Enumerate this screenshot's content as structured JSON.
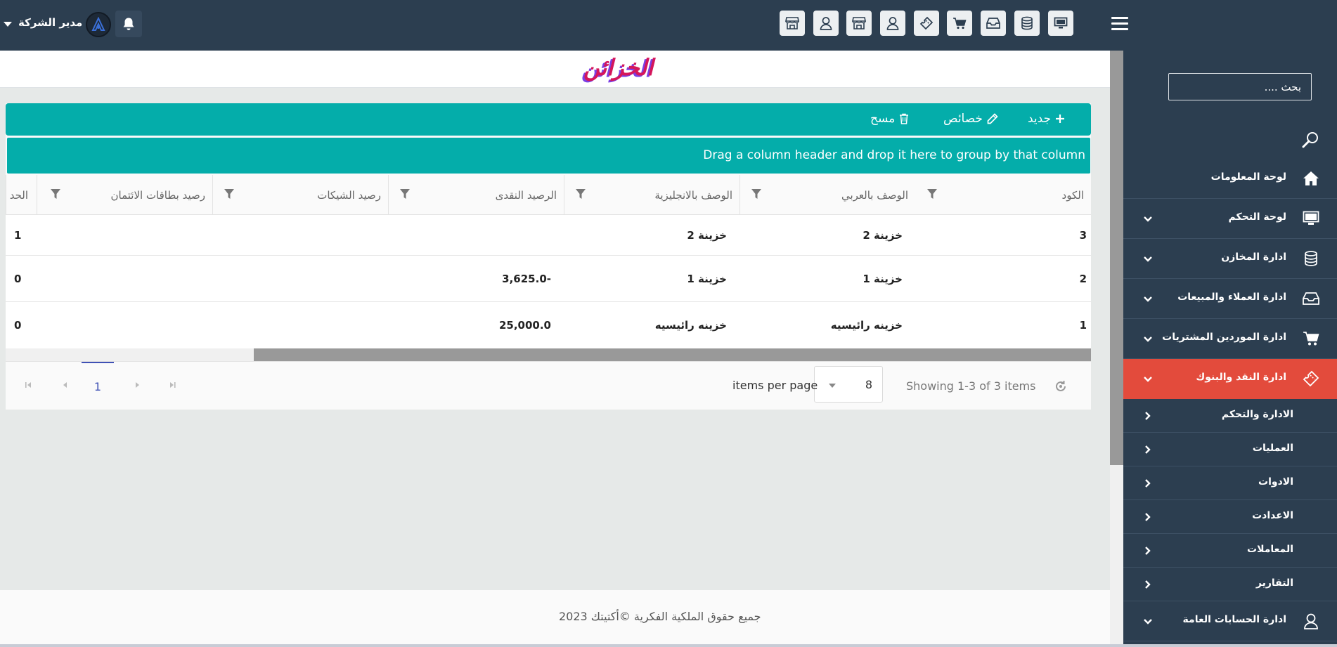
{
  "topbar": {
    "user_name": "مدير الشركة",
    "icons": [
      "monitor-icon",
      "database-icon",
      "inbox-icon",
      "cart-icon",
      "ticket-icon",
      "user-icon",
      "store-icon",
      "user-icon",
      "store-icon"
    ]
  },
  "sidebar": {
    "search_placeholder": "بحث ....",
    "items": [
      {
        "label": "لوحة المعلومات",
        "icon": "home-icon",
        "chevron": false
      },
      {
        "label": "لوحة التحكم",
        "icon": "monitor-icon",
        "chevron": true
      },
      {
        "label": "ادارة المخازن",
        "icon": "database-icon",
        "chevron": true
      },
      {
        "label": "ادارة العملاء والمبيعات",
        "icon": "inbox-icon",
        "chevron": true
      },
      {
        "label": "ادارة الموردين المشتريات",
        "icon": "cart-icon",
        "chevron": true
      },
      {
        "label": "ادارة النقد والبنوك",
        "icon": "ticket-icon",
        "chevron": true,
        "active": true
      }
    ],
    "sub_items": [
      "الادارة والتحكم",
      "العمليات",
      "الادوات",
      "الاعدادت",
      "المعاملات",
      "التقارير"
    ],
    "last_item": {
      "label": "ادارة الحسابات العامة",
      "icon": "user-icon"
    },
    "active_color": "#e34b3c"
  },
  "page": {
    "title": "الخزائن"
  },
  "toolbar": {
    "new_label": "جديد",
    "props_label": "خصائص",
    "delete_label": "مسح"
  },
  "grid": {
    "group_hint": "Drag a column header and drop it here to group by that column",
    "columns": [
      "الكود",
      "الوصف بالعربي",
      "الوصف بالانجليزية",
      "الرصيد النقدى",
      "رصيد الشيكات",
      "رصيد بطاقات الائتمان",
      "الحد"
    ],
    "rows": [
      {
        "code": "3",
        "name_ar": "خزينة 2",
        "name_en": "خزينة 2",
        "cash": "",
        "cheques": "",
        "cards": "",
        "limit": "1"
      },
      {
        "code": "2",
        "name_ar": "خزينة 1",
        "name_en": "خزينة 1",
        "cash": "-3,625.0",
        "cheques": "",
        "cards": "",
        "limit": "0"
      },
      {
        "code": "1",
        "name_ar": "خزينه رائيسيه",
        "name_en": "خزينه رائيسيه",
        "cash": "25,000.0",
        "cheques": "",
        "cards": "",
        "limit": "0"
      }
    ]
  },
  "pager": {
    "showing": "Showing 1-3 of 3 items",
    "per_page_value": "8",
    "per_page_label": "items per page",
    "current_page": "1"
  },
  "footer": {
    "text": "جميع حقوق الملكية الفكرية ©أكتيتك 2023"
  },
  "colors": {
    "topbar": "#2c3e50",
    "teal": "#04adaa",
    "title_pink": "#d4165b"
  }
}
